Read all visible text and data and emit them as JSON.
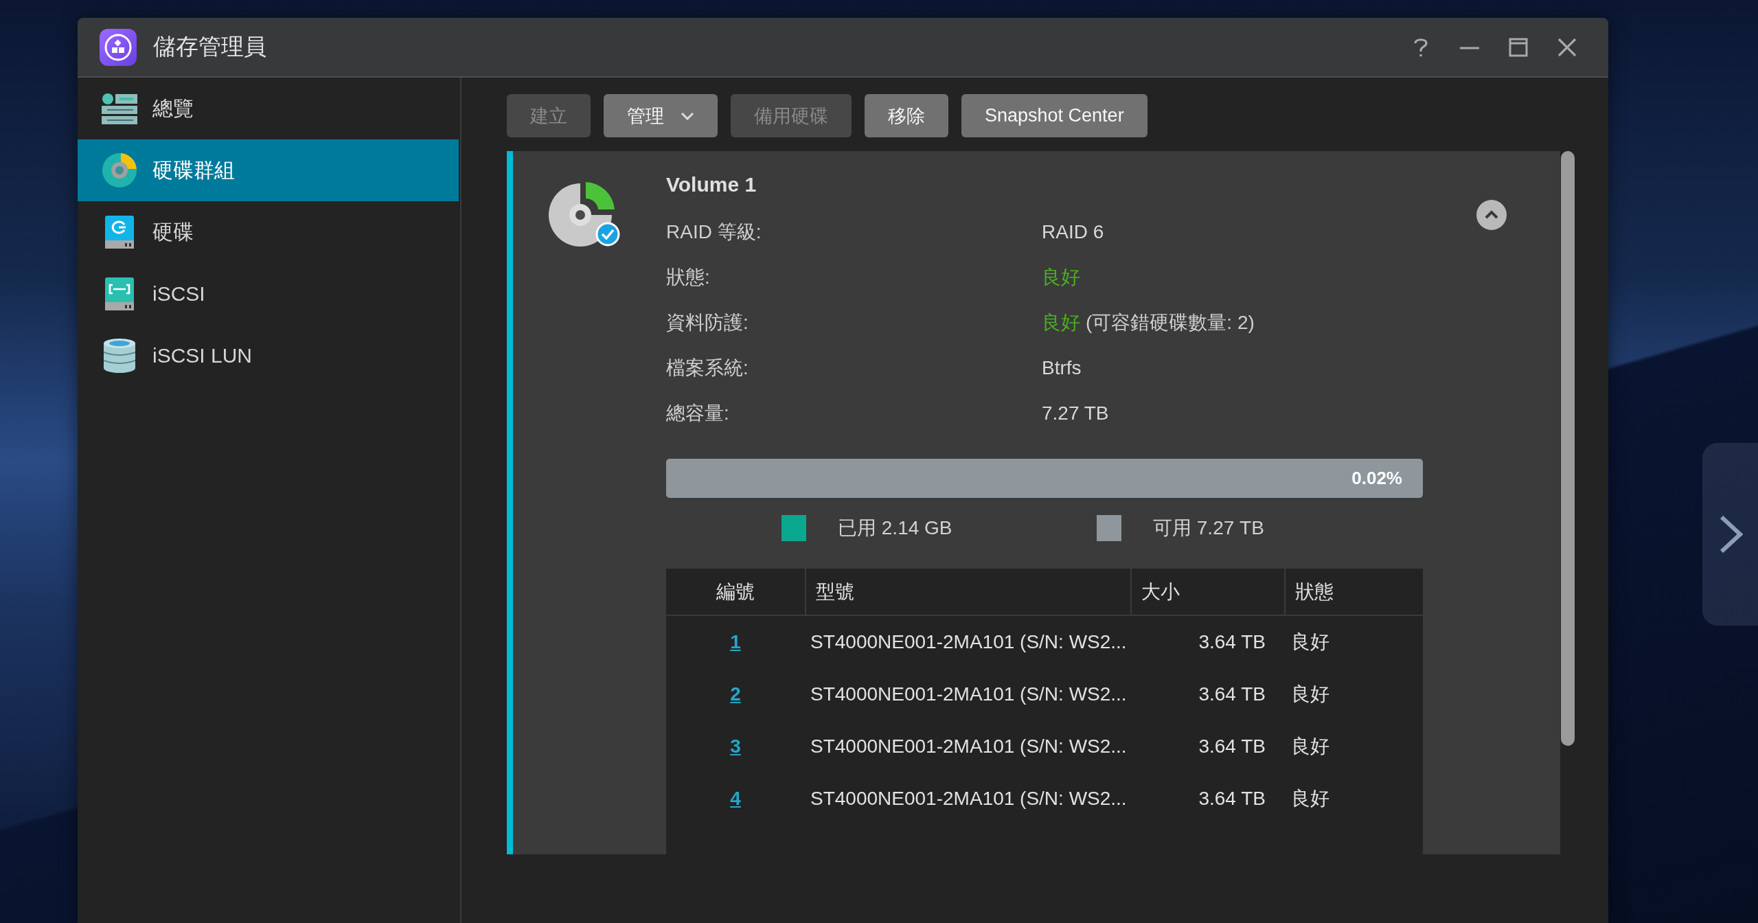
{
  "window": {
    "title": "儲存管理員"
  },
  "sidebar": {
    "items": [
      {
        "kind": "overview",
        "label": "總覽",
        "selected": false
      },
      {
        "kind": "pool",
        "label": "硬碟群組",
        "selected": true
      },
      {
        "kind": "disk",
        "label": "硬碟",
        "selected": false
      },
      {
        "kind": "iscsi",
        "label": "iSCSI",
        "selected": false
      },
      {
        "kind": "lun",
        "label": "iSCSI LUN",
        "selected": false
      }
    ]
  },
  "toolbar": {
    "buttons": [
      {
        "kind": "button",
        "label": "建立",
        "disabled": true
      },
      {
        "kind": "dropdown",
        "label": "管理",
        "disabled": false
      },
      {
        "kind": "button",
        "label": "備用硬碟",
        "disabled": true
      },
      {
        "kind": "button",
        "label": "移除",
        "disabled": false
      },
      {
        "kind": "button",
        "label": "Snapshot Center",
        "disabled": false
      }
    ]
  },
  "volume": {
    "title": "Volume 1",
    "expanded": true,
    "details": [
      {
        "kind": "text",
        "label": "RAID 等級:",
        "value": "RAID 6"
      },
      {
        "kind": "status",
        "label": "狀態:",
        "value": "良好"
      },
      {
        "kind": "status",
        "label": "資料防護:",
        "value": "良好",
        "note": "(可容錯硬碟數量: 2)"
      },
      {
        "kind": "text",
        "label": "檔案系統:",
        "value": "Btrfs"
      },
      {
        "kind": "text",
        "label": "總容量:",
        "value": "7.27 TB"
      }
    ],
    "usage": {
      "percent": "0.02%",
      "legend": [
        {
          "label": "已用 2.14 GB",
          "color": "#0aa88f"
        },
        {
          "label": "可用 7.27 TB",
          "color": "#8f979c"
        }
      ]
    },
    "disks": {
      "columns": [
        "編號",
        "型號",
        "大小",
        "狀態"
      ],
      "rows": [
        {
          "number": "1",
          "model": "ST4000NE001-2MA101 (S/N: WS2...",
          "size": "3.64 TB",
          "status": "良好"
        },
        {
          "number": "2",
          "model": "ST4000NE001-2MA101 (S/N: WS2...",
          "size": "3.64 TB",
          "status": "良好"
        },
        {
          "number": "3",
          "model": "ST4000NE001-2MA101 (S/N: WS2...",
          "size": "3.64 TB",
          "status": "良好"
        },
        {
          "number": "4",
          "model": "ST4000NE001-2MA101 (S/N: WS2...",
          "size": "3.64 TB",
          "status": "良好"
        }
      ]
    }
  }
}
